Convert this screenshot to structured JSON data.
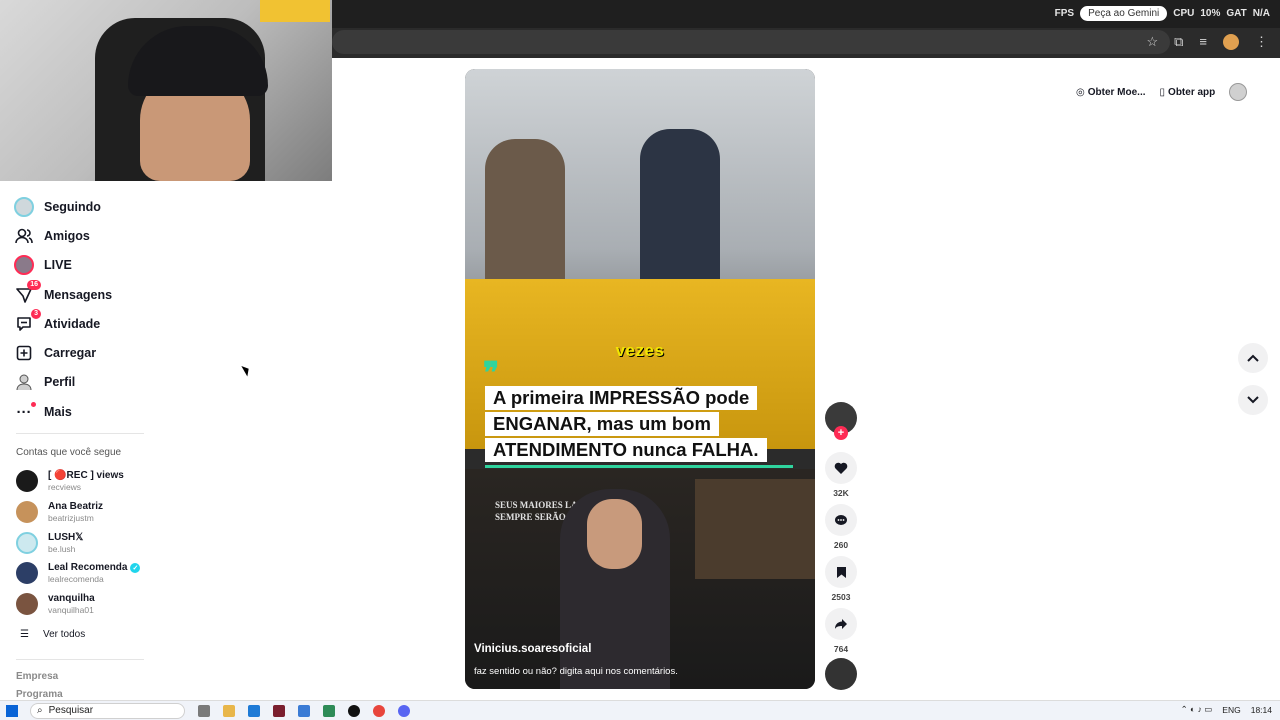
{
  "overlay": {
    "fps_label": "FPS",
    "gemini_label": "Peça ao Gemini",
    "cpu_label": "CPU",
    "cpu_value": "10%",
    "gpu_label": "GAT",
    "gpu_value": "N/A"
  },
  "sidebar": {
    "items": [
      {
        "label": "Seguindo",
        "icon": "following-avatar-icon"
      },
      {
        "label": "Amigos",
        "icon": "friends-icon"
      },
      {
        "label": "LIVE",
        "icon": "live-avatar-icon"
      },
      {
        "label": "Mensagens",
        "icon": "messages-icon",
        "badge": "16"
      },
      {
        "label": "Atividade",
        "icon": "activity-icon",
        "badge": "3"
      },
      {
        "label": "Carregar",
        "icon": "upload-icon"
      },
      {
        "label": "Perfil",
        "icon": "profile-icon"
      },
      {
        "label": "Mais",
        "icon": "more-icon"
      }
    ],
    "following_title": "Contas que você segue",
    "accounts": [
      {
        "name": "[ 🔴REC ] views",
        "handle": "recviews",
        "verified": false
      },
      {
        "name": "Ana Beatriz",
        "handle": "beatrizjustm",
        "verified": false
      },
      {
        "name": "LUSH𝕏",
        "handle": "be.lush",
        "verified": false
      },
      {
        "name": "Leal Recomenda",
        "handle": "lealrecomenda",
        "verified": true
      },
      {
        "name": "vanquilha",
        "handle": "vanquilha01",
        "verified": false
      }
    ],
    "see_all": "Ver todos",
    "footer": [
      "Empresa",
      "Programa"
    ]
  },
  "video": {
    "word": "vezes",
    "caption_lines": [
      "A primeira IMPRESSÃO pode",
      "ENGANAR, mas um bom",
      "ATENDIMENTO nunca FALHA."
    ],
    "wall_text": [
      "SEUS MAIORES LANÇAMENTOS",
      "SEMPRE SERÃO PESSOAS"
    ],
    "author": "Vinicius.soaresoficial",
    "description": "faz sentido ou não? digita aqui nos comentários."
  },
  "actions": {
    "likes": "32K",
    "comments": "260",
    "saves": "2503",
    "shares": "764"
  },
  "topright": {
    "coins_label": "Obter Moe...",
    "app_label": "Obter app"
  },
  "taskbar": {
    "search_placeholder": "Pesquisar",
    "lang": "ENG",
    "time": "18:14"
  }
}
